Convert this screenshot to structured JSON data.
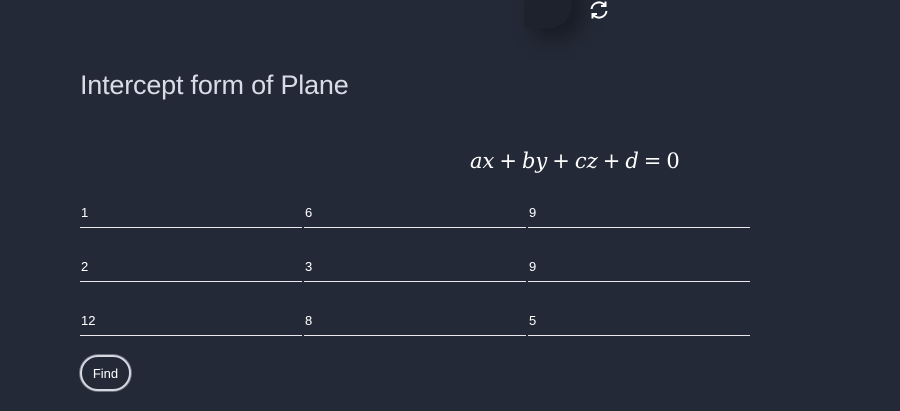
{
  "title": "Intercept form of Plane",
  "equation": {
    "parts": [
      "ax",
      "+",
      "by",
      "+",
      "cz",
      "+",
      "d",
      "=",
      "0"
    ]
  },
  "inputs": [
    [
      "1",
      "6",
      "9"
    ],
    [
      "2",
      "3",
      "9"
    ],
    [
      "12",
      "8",
      "5"
    ]
  ],
  "find_label": "Find",
  "icons": {
    "refresh": "refresh-icon"
  }
}
